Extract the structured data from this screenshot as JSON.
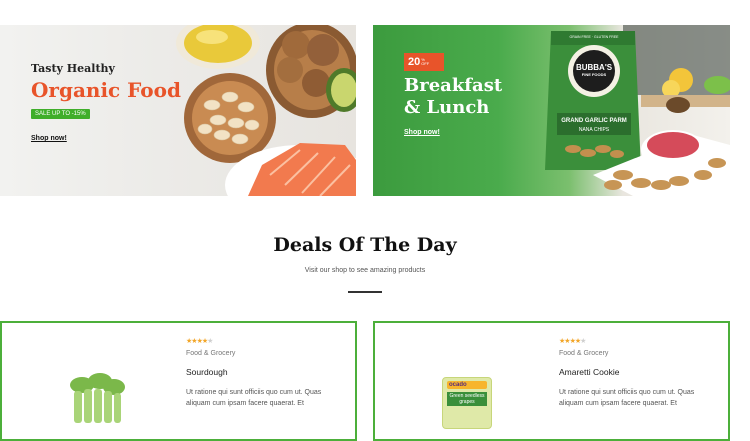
{
  "banner_organic": {
    "subtitle": "Tasty Healthy",
    "title": "Organic Food",
    "sale_badge": "SALE UP TO -15%",
    "shop_link": "Shop now!"
  },
  "banner_breakfast": {
    "discount_number": "20",
    "discount_symbol": "%",
    "discount_off": "OFF",
    "title_line1": "Breakfast",
    "title_line2": "& Lunch",
    "shop_link": "Shop now!",
    "package_brand_line1": "BUBBA'S",
    "package_brand_line2": "FINE FOODS",
    "package_top": "GRAIN FREE · GLUTEN FREE",
    "package_product": "GRAND GARLIC PARM",
    "package_sub": "NANA CHIPS"
  },
  "deals": {
    "title": "Deals Of The Day",
    "subtitle": "Visit our shop to see amazing products"
  },
  "products": [
    {
      "rating": 4,
      "category": "Food & Grocery",
      "name": "Sourdough",
      "description": "Ut ratione qui sunt officiis quo cum ut. Quas aliquam cum ipsam facere quaerat. Et"
    },
    {
      "rating": 4,
      "category": "Food & Grocery",
      "name": "Amaretti Cookie",
      "description": "Ut ratione qui sunt officiis quo cum ut. Quas aliquam cum ipsam facere quaerat. Et",
      "package_brand": "ocado",
      "package_label": "Green seedless grapes"
    }
  ],
  "colors": {
    "accent_orange": "#e8542a",
    "accent_green": "#3fae2a",
    "card_border": "#4caf3a",
    "star": "#f2a629"
  }
}
